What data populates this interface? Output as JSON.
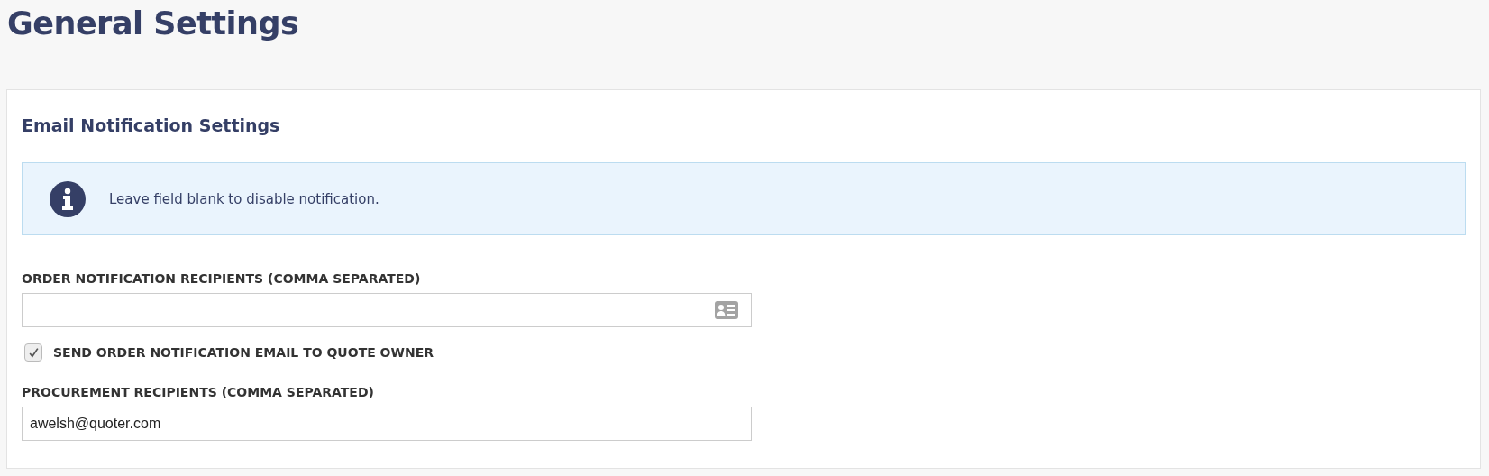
{
  "page_title": "General Settings",
  "section": {
    "heading": "Email Notification Settings",
    "notice": {
      "text": "Leave field blank to disable notification."
    },
    "fields": [
      {
        "kind": "input",
        "label": "ORDER NOTIFICATION RECIPIENTS (COMMA SEPARATED)",
        "contact_picker": true
      },
      {
        "kind": "checkbox",
        "label": "SEND ORDER NOTIFICATION EMAIL TO QUOTE OWNER",
        "checked": true
      },
      {
        "kind": "input",
        "label": "PROCUREMENT RECIPIENTS (COMMA SEPARATED)",
        "value": "awelsh@quoter.com",
        "contact_picker": false
      }
    ]
  }
}
